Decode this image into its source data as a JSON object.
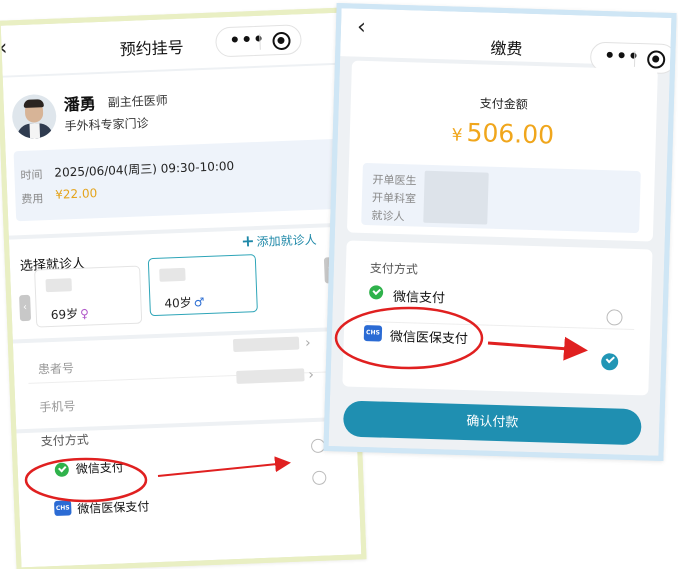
{
  "colors": {
    "accent": "#1f8fb1",
    "amount": "#f0a61c",
    "fee": "#e4a31a",
    "wechat_green": "#2fb24b",
    "medical_insurance_blue": "#2b6bd4",
    "annotation_red": "#e02020",
    "left_frame": "#e9efc3",
    "right_frame": "#cfe6f5"
  },
  "left_screen": {
    "nav": {
      "back_icon": "‹",
      "title": "预约挂号",
      "menu_icon": "•••",
      "close_icon": "target-icon"
    },
    "doctor": {
      "name": "潘勇",
      "title": "副主任医师",
      "department": "手外科专家门诊"
    },
    "appointment": {
      "time_label": "时间",
      "time_value": "2025/06/04(周三) 09:30-10:00",
      "fee_label": "费用",
      "fee_value": "¥22.00"
    },
    "patients": {
      "section_title": "选择就诊人",
      "add_label": "添加就诊人",
      "add_icon": "+",
      "left_arrow": "‹",
      "right_arrow": "›",
      "cards": [
        {
          "age": "69岁",
          "gender_symbol": "♀"
        },
        {
          "age": "40岁",
          "gender_symbol": "♂"
        }
      ]
    },
    "rows": [
      {
        "label": "患者号",
        "chevron": "›"
      },
      {
        "label": "手机号",
        "chevron": "›"
      }
    ],
    "payment": {
      "title": "支付方式",
      "options": [
        {
          "label": "微信支付"
        },
        {
          "label": "微信医保支付",
          "icon_text": "CHS"
        }
      ]
    }
  },
  "right_screen": {
    "nav": {
      "back_icon": "‹",
      "title": "缴费",
      "menu_icon": "•••",
      "close_icon": "target-icon"
    },
    "amount": {
      "label": "支付金额",
      "currency": "¥",
      "value": "506.00",
      "info_labels": [
        "开单医生",
        "开单科室",
        "就诊人"
      ]
    },
    "payment": {
      "title": "支付方式",
      "options": [
        {
          "label": "微信支付",
          "selected": false
        },
        {
          "label": "微信医保支付",
          "icon_text": "CHS",
          "selected": true
        }
      ]
    },
    "confirm_button": "确认付款"
  }
}
